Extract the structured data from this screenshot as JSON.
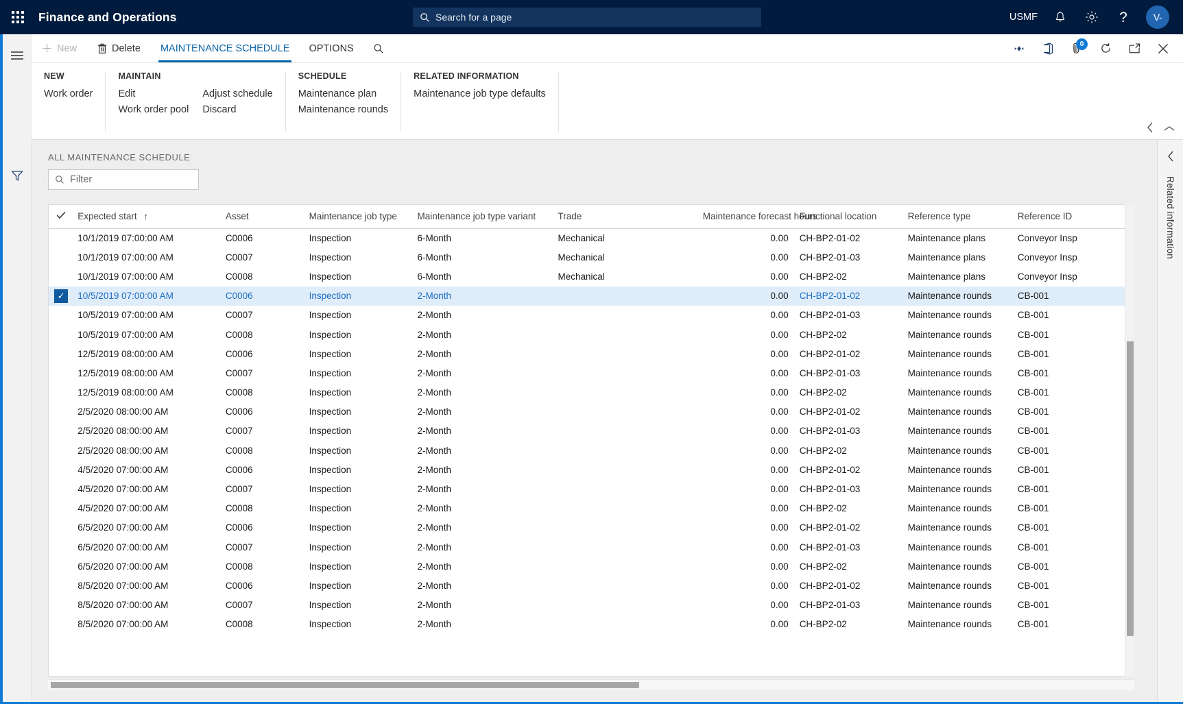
{
  "topbar": {
    "waffle_icon": "app-launcher-icon",
    "app_title": "Finance and Operations",
    "search_placeholder": "Search for a page",
    "search_icon": "search-icon",
    "company": "USMF",
    "notifications_icon": "bell-icon",
    "settings_icon": "gear-icon",
    "help_icon": "question-icon",
    "avatar_initials": "V-"
  },
  "action_pane": {
    "new_label": "New",
    "new_icon": "plus-icon",
    "delete_label": "Delete",
    "delete_icon": "trash-icon",
    "tab_maintenance_schedule": "MAINTENANCE SCHEDULE",
    "tab_options": "OPTIONS",
    "search_icon": "search-icon",
    "right_icons": [
      {
        "name": "share-icon",
        "label": "Share"
      },
      {
        "name": "office-icon",
        "label": "Open in Microsoft Office"
      },
      {
        "name": "attachment-icon",
        "label": "Attachments",
        "badge": "0"
      },
      {
        "name": "refresh-icon",
        "label": "Refresh"
      },
      {
        "name": "popout-icon",
        "label": "Open in new window"
      },
      {
        "name": "close-icon",
        "label": "Close"
      }
    ]
  },
  "ribbon": {
    "groups": [
      {
        "title": "NEW",
        "columns": [
          {
            "items": [
              "Work order"
            ]
          }
        ]
      },
      {
        "title": "MAINTAIN",
        "columns": [
          {
            "items": [
              "Edit",
              "Work order pool"
            ]
          },
          {
            "items": [
              "Adjust schedule",
              "Discard"
            ]
          }
        ]
      },
      {
        "title": "SCHEDULE",
        "columns": [
          {
            "items": [
              "Maintenance plan",
              "Maintenance rounds"
            ]
          }
        ]
      },
      {
        "title": "RELATED INFORMATION",
        "columns": [
          {
            "items": [
              "Maintenance job type defaults"
            ]
          }
        ]
      }
    ],
    "collapse_icon": "chevron-up-icon"
  },
  "grid_section": {
    "caption": "ALL MAINTENANCE SCHEDULE",
    "filter_placeholder": "Filter",
    "filter_icon": "search-icon",
    "sort_indicator": "↑",
    "columns": [
      "Expected start",
      "Asset",
      "Maintenance job type",
      "Maintenance job type variant",
      "Trade",
      "Maintenance forecast hours",
      "Functional location",
      "Reference type",
      "Reference ID"
    ],
    "rows": [
      {
        "selected": false,
        "expected_start": "10/1/2019 07:00:00 AM",
        "asset": "C0006",
        "job_type": "Inspection",
        "variant": "6-Month",
        "trade": "Mechanical",
        "hours": "0.00",
        "functional_location": "CH-BP2-01-02",
        "reference_type": "Maintenance plans",
        "reference_id": "Conveyor Insp"
      },
      {
        "selected": false,
        "expected_start": "10/1/2019 07:00:00 AM",
        "asset": "C0007",
        "job_type": "Inspection",
        "variant": "6-Month",
        "trade": "Mechanical",
        "hours": "0.00",
        "functional_location": "CH-BP2-01-03",
        "reference_type": "Maintenance plans",
        "reference_id": "Conveyor Insp"
      },
      {
        "selected": false,
        "expected_start": "10/1/2019 07:00:00 AM",
        "asset": "C0008",
        "job_type": "Inspection",
        "variant": "6-Month",
        "trade": "Mechanical",
        "hours": "0.00",
        "functional_location": "CH-BP2-02",
        "reference_type": "Maintenance plans",
        "reference_id": "Conveyor Insp"
      },
      {
        "selected": true,
        "expected_start": "10/5/2019 07:00:00 AM",
        "asset": "C0006",
        "job_type": "Inspection",
        "variant": "2-Month",
        "trade": "",
        "hours": "0.00",
        "functional_location": "CH-BP2-01-02",
        "reference_type": "Maintenance rounds",
        "reference_id": "CB-001"
      },
      {
        "selected": false,
        "expected_start": "10/5/2019 07:00:00 AM",
        "asset": "C0007",
        "job_type": "Inspection",
        "variant": "2-Month",
        "trade": "",
        "hours": "0.00",
        "functional_location": "CH-BP2-01-03",
        "reference_type": "Maintenance rounds",
        "reference_id": "CB-001"
      },
      {
        "selected": false,
        "expected_start": "10/5/2019 07:00:00 AM",
        "asset": "C0008",
        "job_type": "Inspection",
        "variant": "2-Month",
        "trade": "",
        "hours": "0.00",
        "functional_location": "CH-BP2-02",
        "reference_type": "Maintenance rounds",
        "reference_id": "CB-001"
      },
      {
        "selected": false,
        "expected_start": "12/5/2019 08:00:00 AM",
        "asset": "C0006",
        "job_type": "Inspection",
        "variant": "2-Month",
        "trade": "",
        "hours": "0.00",
        "functional_location": "CH-BP2-01-02",
        "reference_type": "Maintenance rounds",
        "reference_id": "CB-001"
      },
      {
        "selected": false,
        "expected_start": "12/5/2019 08:00:00 AM",
        "asset": "C0007",
        "job_type": "Inspection",
        "variant": "2-Month",
        "trade": "",
        "hours": "0.00",
        "functional_location": "CH-BP2-01-03",
        "reference_type": "Maintenance rounds",
        "reference_id": "CB-001"
      },
      {
        "selected": false,
        "expected_start": "12/5/2019 08:00:00 AM",
        "asset": "C0008",
        "job_type": "Inspection",
        "variant": "2-Month",
        "trade": "",
        "hours": "0.00",
        "functional_location": "CH-BP2-02",
        "reference_type": "Maintenance rounds",
        "reference_id": "CB-001"
      },
      {
        "selected": false,
        "expected_start": "2/5/2020 08:00:00 AM",
        "asset": "C0006",
        "job_type": "Inspection",
        "variant": "2-Month",
        "trade": "",
        "hours": "0.00",
        "functional_location": "CH-BP2-01-02",
        "reference_type": "Maintenance rounds",
        "reference_id": "CB-001"
      },
      {
        "selected": false,
        "expected_start": "2/5/2020 08:00:00 AM",
        "asset": "C0007",
        "job_type": "Inspection",
        "variant": "2-Month",
        "trade": "",
        "hours": "0.00",
        "functional_location": "CH-BP2-01-03",
        "reference_type": "Maintenance rounds",
        "reference_id": "CB-001"
      },
      {
        "selected": false,
        "expected_start": "2/5/2020 08:00:00 AM",
        "asset": "C0008",
        "job_type": "Inspection",
        "variant": "2-Month",
        "trade": "",
        "hours": "0.00",
        "functional_location": "CH-BP2-02",
        "reference_type": "Maintenance rounds",
        "reference_id": "CB-001"
      },
      {
        "selected": false,
        "expected_start": "4/5/2020 07:00:00 AM",
        "asset": "C0006",
        "job_type": "Inspection",
        "variant": "2-Month",
        "trade": "",
        "hours": "0.00",
        "functional_location": "CH-BP2-01-02",
        "reference_type": "Maintenance rounds",
        "reference_id": "CB-001"
      },
      {
        "selected": false,
        "expected_start": "4/5/2020 07:00:00 AM",
        "asset": "C0007",
        "job_type": "Inspection",
        "variant": "2-Month",
        "trade": "",
        "hours": "0.00",
        "functional_location": "CH-BP2-01-03",
        "reference_type": "Maintenance rounds",
        "reference_id": "CB-001"
      },
      {
        "selected": false,
        "expected_start": "4/5/2020 07:00:00 AM",
        "asset": "C0008",
        "job_type": "Inspection",
        "variant": "2-Month",
        "trade": "",
        "hours": "0.00",
        "functional_location": "CH-BP2-02",
        "reference_type": "Maintenance rounds",
        "reference_id": "CB-001"
      },
      {
        "selected": false,
        "expected_start": "6/5/2020 07:00:00 AM",
        "asset": "C0006",
        "job_type": "Inspection",
        "variant": "2-Month",
        "trade": "",
        "hours": "0.00",
        "functional_location": "CH-BP2-01-02",
        "reference_type": "Maintenance rounds",
        "reference_id": "CB-001"
      },
      {
        "selected": false,
        "expected_start": "6/5/2020 07:00:00 AM",
        "asset": "C0007",
        "job_type": "Inspection",
        "variant": "2-Month",
        "trade": "",
        "hours": "0.00",
        "functional_location": "CH-BP2-01-03",
        "reference_type": "Maintenance rounds",
        "reference_id": "CB-001"
      },
      {
        "selected": false,
        "expected_start": "6/5/2020 07:00:00 AM",
        "asset": "C0008",
        "job_type": "Inspection",
        "variant": "2-Month",
        "trade": "",
        "hours": "0.00",
        "functional_location": "CH-BP2-02",
        "reference_type": "Maintenance rounds",
        "reference_id": "CB-001"
      },
      {
        "selected": false,
        "expected_start": "8/5/2020 07:00:00 AM",
        "asset": "C0006",
        "job_type": "Inspection",
        "variant": "2-Month",
        "trade": "",
        "hours": "0.00",
        "functional_location": "CH-BP2-01-02",
        "reference_type": "Maintenance rounds",
        "reference_id": "CB-001"
      },
      {
        "selected": false,
        "expected_start": "8/5/2020 07:00:00 AM",
        "asset": "C0007",
        "job_type": "Inspection",
        "variant": "2-Month",
        "trade": "",
        "hours": "0.00",
        "functional_location": "CH-BP2-01-03",
        "reference_type": "Maintenance rounds",
        "reference_id": "CB-001"
      },
      {
        "selected": false,
        "expected_start": "8/5/2020 07:00:00 AM",
        "asset": "C0008",
        "job_type": "Inspection",
        "variant": "2-Month",
        "trade": "",
        "hours": "0.00",
        "functional_location": "CH-BP2-02",
        "reference_type": "Maintenance rounds",
        "reference_id": "CB-001"
      }
    ]
  },
  "related_panel": {
    "label": "Related information",
    "collapse_icon": "chevron-left-icon"
  },
  "left_rail": {
    "menu_icon": "hamburger-icon",
    "filter_icon": "funnel-icon"
  },
  "colors": {
    "nav_bg": "#001b3d",
    "accent": "#0f7bd4",
    "link": "#1b6ec2",
    "selected_row": "#dfecf9",
    "tab_active": "#0a64a8"
  }
}
